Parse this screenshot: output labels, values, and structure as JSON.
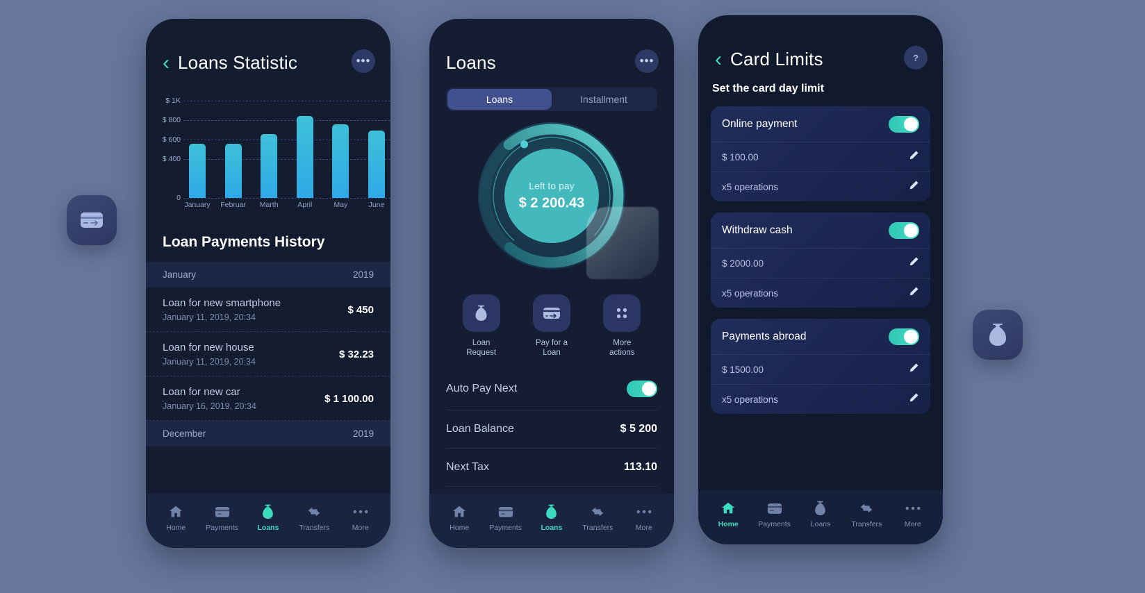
{
  "theme": {
    "page_bg": "#67779c",
    "phone_bg": "#141c30",
    "accent_teal": "#3ddbc0",
    "accent_blue": "#2fa9e8",
    "card_blue": "#41508f"
  },
  "float_icons": {
    "left": {
      "name": "card-app-icon"
    },
    "right": {
      "name": "money-bag-app-icon"
    }
  },
  "phone1": {
    "header": {
      "title": "Loans Statistic",
      "back": "‹",
      "menu": "•••"
    },
    "chart_data": {
      "type": "bar",
      "title": "Loans Statistic",
      "categories": [
        "January",
        "Februar",
        "Marth",
        "April",
        "May",
        "June"
      ],
      "values": [
        555,
        555,
        655,
        845,
        760,
        690
      ],
      "ytick_labels": [
        "$ 1K",
        "$ 800",
        "$ 600",
        "$ 400",
        "0"
      ],
      "ytick_values": [
        1000,
        800,
        600,
        400,
        0
      ],
      "ylim": [
        0,
        1050
      ],
      "xlabel": "",
      "ylabel": "",
      "grid": true,
      "legend": "none"
    },
    "history": {
      "section_title": "Loan Payments History",
      "groups": [
        {
          "month": "January",
          "year": "2019",
          "items": [
            {
              "title": "Loan for new smartphone",
              "date": "January 11, 2019, 20:34",
              "amount": "$ 450"
            },
            {
              "title": "Loan for new house",
              "date": "January 11, 2019, 20:34",
              "amount": "$ 32.23"
            },
            {
              "title": "Loan for new car",
              "date": "January 16, 2019, 20:34",
              "amount": "$ 1 100.00"
            }
          ]
        },
        {
          "month": "December",
          "year": "2019",
          "items": []
        }
      ]
    },
    "nav": [
      {
        "label": "Home",
        "icon": "home-icon",
        "active": false
      },
      {
        "label": "Payments",
        "icon": "card-icon",
        "active": false
      },
      {
        "label": "Loans",
        "icon": "money-bag-icon",
        "active": true
      },
      {
        "label": "Transfers",
        "icon": "transfer-arrows-icon",
        "active": false
      },
      {
        "label": "More",
        "icon": "more-dots-icon",
        "active": false
      }
    ]
  },
  "phone2": {
    "header": {
      "title": "Loans",
      "menu": "•••"
    },
    "tabs": [
      {
        "label": "Loans",
        "active": true
      },
      {
        "label": "Installment",
        "active": false
      }
    ],
    "ring": {
      "label": "Left to pay",
      "value": "$ 2 200.43",
      "progress_percent": 72
    },
    "actions": [
      {
        "label": "Loan\nRequest",
        "line1": "Loan",
        "line2": "Request",
        "icon": "money-bag-icon"
      },
      {
        "label": "Pay for a\nLoan",
        "line1": "Pay for a",
        "line2": "Loan",
        "icon": "card-transfer-icon"
      },
      {
        "label": "More\nactions",
        "line1": "More",
        "line2": "actions",
        "icon": "grid-dots-icon"
      }
    ],
    "rows": [
      {
        "label": "Auto Pay Next",
        "type": "toggle",
        "value": "on"
      },
      {
        "label": "Loan Balance",
        "type": "value",
        "value": "$ 5 200"
      },
      {
        "label": "Next Tax",
        "type": "value",
        "value": "113.10"
      }
    ],
    "nav": [
      {
        "label": "Home",
        "icon": "home-icon",
        "active": false
      },
      {
        "label": "Payments",
        "icon": "card-icon",
        "active": false
      },
      {
        "label": "Loans",
        "icon": "money-bag-icon",
        "active": true
      },
      {
        "label": "Transfers",
        "icon": "transfer-arrows-icon",
        "active": false
      },
      {
        "label": "More",
        "icon": "more-dots-icon",
        "active": false
      }
    ]
  },
  "phone3": {
    "header": {
      "title": "Card Limits",
      "back": "‹",
      "help": "?"
    },
    "subtitle": "Set the card day limit",
    "cards": [
      {
        "name": "Online payment",
        "toggle": "on",
        "amount": "$ 100.00",
        "operations": "x5 operations"
      },
      {
        "name": "Withdraw cash",
        "toggle": "on",
        "amount": "$ 2000.00",
        "operations": "x5 operations"
      },
      {
        "name": "Payments abroad",
        "toggle": "on",
        "amount": "$ 1500.00",
        "operations": "x5 operations"
      }
    ],
    "nav": [
      {
        "label": "Home",
        "icon": "home-icon",
        "active": true
      },
      {
        "label": "Payments",
        "icon": "card-icon",
        "active": false
      },
      {
        "label": "Loans",
        "icon": "money-bag-icon",
        "active": false
      },
      {
        "label": "Transfers",
        "icon": "transfer-arrows-icon",
        "active": false
      },
      {
        "label": "More",
        "icon": "more-dots-icon",
        "active": false
      }
    ]
  }
}
